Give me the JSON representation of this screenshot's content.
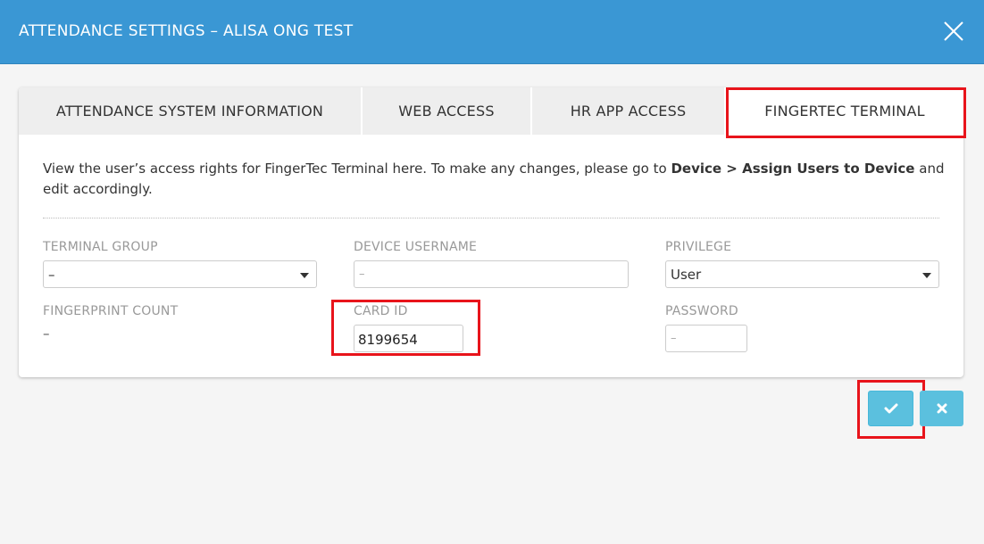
{
  "dialog": {
    "title": "ATTENDANCE SETTINGS – ALISA ONG TEST",
    "close_icon": "close-icon"
  },
  "tabs": [
    {
      "label": "ATTENDANCE SYSTEM INFORMATION",
      "active": false
    },
    {
      "label": "WEB ACCESS",
      "active": false
    },
    {
      "label": "HR APP ACCESS",
      "active": false
    },
    {
      "label": "FINGERTEC TERMINAL",
      "active": true
    }
  ],
  "description": {
    "text_before": "View the user’s access rights for FingerTec Terminal here. To make any changes, please go to ",
    "link_text": "Device > Assign Users to Device",
    "text_after": " and edit accordingly."
  },
  "fields": {
    "terminal_group": {
      "label": "TERMINAL GROUP",
      "value": "–"
    },
    "device_username": {
      "label": "DEVICE USERNAME",
      "placeholder": "–"
    },
    "privilege": {
      "label": "PRIVILEGE",
      "value": "User"
    },
    "fingerprint_count": {
      "label": "FINGERPRINT COUNT",
      "value": "–"
    },
    "card_id": {
      "label": "CARD ID",
      "value": "8199654"
    },
    "password": {
      "label": "PASSWORD",
      "placeholder": "–"
    }
  },
  "actions": {
    "confirm_icon": "check-icon",
    "cancel_icon": "x-icon"
  },
  "colors": {
    "header_bg": "#3a97d4",
    "button_bg": "#5bc0de",
    "highlight": "#e8141b"
  }
}
